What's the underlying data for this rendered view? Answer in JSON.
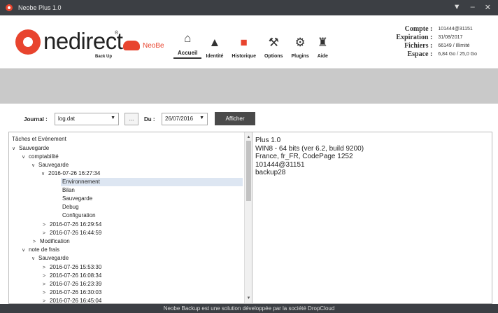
{
  "window": {
    "title": "Neobe Plus 1.0",
    "min": "‒",
    "close": "✕",
    "pin": "▼"
  },
  "logo": {
    "brand": "nedirect",
    "registered": "®",
    "sub": "Back Up",
    "neobe": "NeoBe"
  },
  "toolbar": {
    "items": [
      {
        "label": "Accueil",
        "icon": "home-icon",
        "glyph": "⌂"
      },
      {
        "label": "Identité",
        "icon": "user-icon",
        "glyph": "▲"
      },
      {
        "label": "Historique",
        "icon": "history-icon",
        "glyph": "■"
      },
      {
        "label": "Options",
        "icon": "tools-icon",
        "glyph": "⚒"
      },
      {
        "label": "Plugins",
        "icon": "gears-icon",
        "glyph": "⚙"
      },
      {
        "label": "Aide",
        "icon": "help-icon",
        "glyph": "♜"
      }
    ]
  },
  "account": {
    "compte_label": "Compte :",
    "compte_value": "101444@31151",
    "expiration_label": "Expiration :",
    "expiration_value": "31/08/2017",
    "fichiers_label": "Fichiers :",
    "fichiers_value": "66149 / Illimité",
    "espace_label": "Espace :",
    "espace_value": "6,84 Go / 25,0 Go"
  },
  "filter": {
    "journal_label": "Journal :",
    "journal_value": "log.dat",
    "browse_label": "...",
    "du_label": "Du :",
    "du_value": "26/07/2016",
    "afficher_label": "Afficher"
  },
  "tree": {
    "header": "Tâches et Evénement",
    "rows": [
      "Sauvegarde",
      "comptabilité",
      "Sauvegarde",
      "2016-07-26 16:27:34",
      "Environnement",
      "Bilan",
      "Sauvegarde",
      "Debug",
      "Configuration",
      "2016-07-26 16:29:54",
      "2016-07-26 16:44:59",
      "Modification",
      "note de frais",
      "Sauvegarde",
      "2016-07-26 15:53:30",
      "2016-07-26 16:08:34",
      "2016-07-26 16:23:39",
      "2016-07-26 16:30:03",
      "2016-07-26 16:45:04"
    ]
  },
  "info": {
    "lines": [
      "Plus 1.0",
      "WIN8 - 64 bits (ver 6.2, build 9200)",
      "France, fr_FR, CodePage 1252",
      "101444@31151",
      "backup28"
    ]
  },
  "footer": {
    "text": "Neobe Backup est une solution développée par la société DropCloud"
  }
}
